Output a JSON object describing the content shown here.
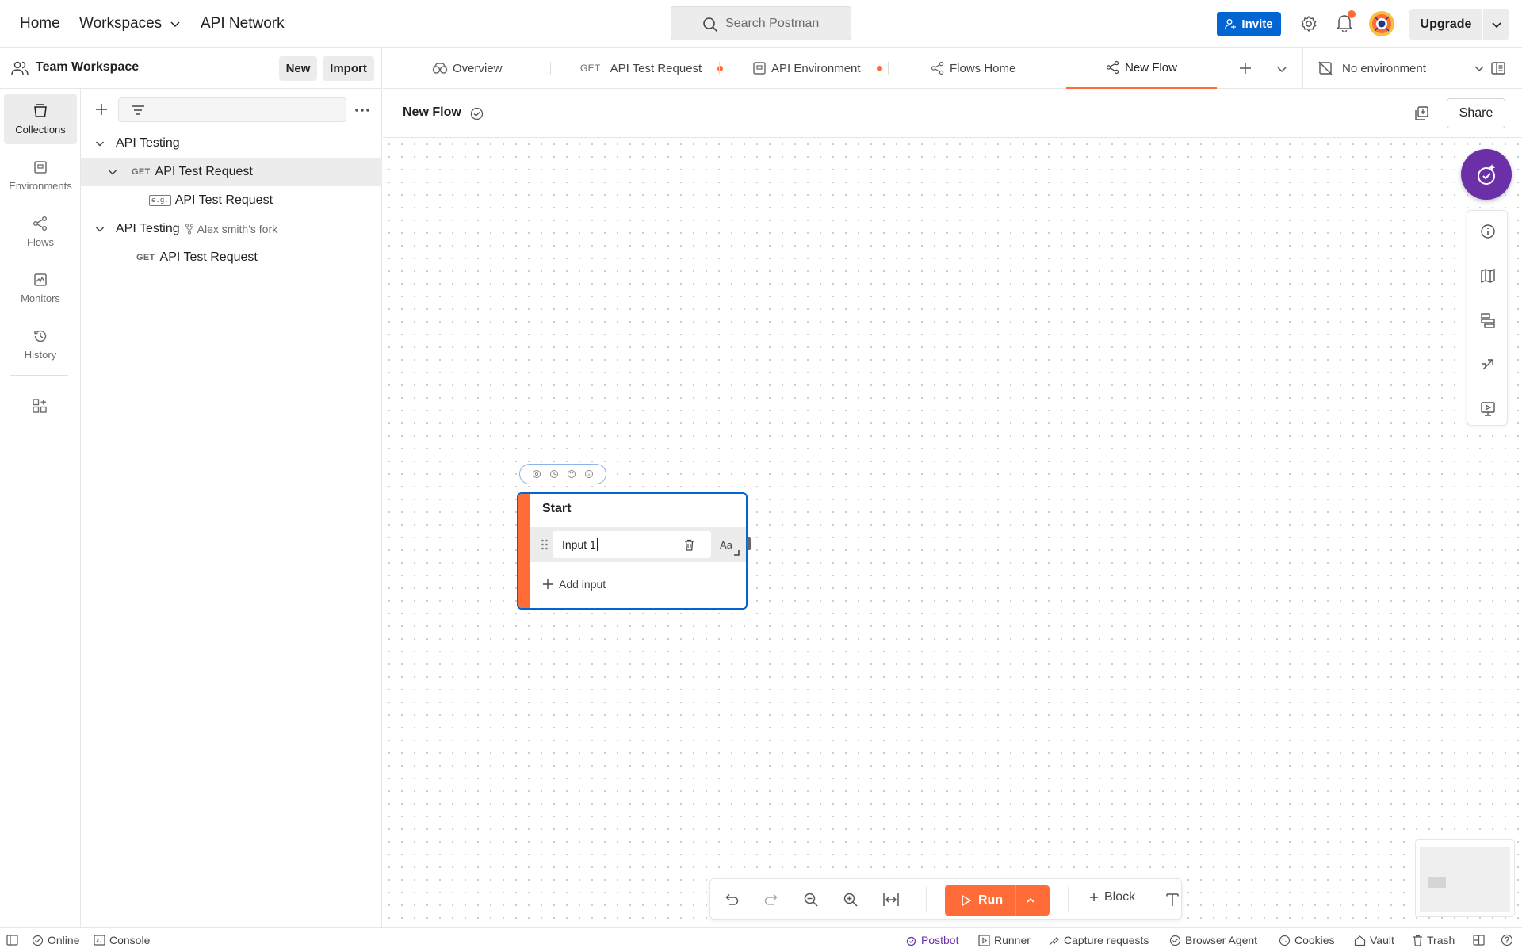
{
  "topbar": {
    "home": "Home",
    "workspaces": "Workspaces",
    "api_network": "API Network",
    "search_placeholder": "Search Postman",
    "invite": "Invite",
    "upgrade": "Upgrade"
  },
  "workspace": {
    "name": "Team Workspace",
    "new_label": "New",
    "import_label": "Import"
  },
  "rail": {
    "items": [
      {
        "label": "Collections",
        "icon": "collections-icon"
      },
      {
        "label": "Environments",
        "icon": "environments-icon"
      },
      {
        "label": "Flows",
        "icon": "flows-icon"
      },
      {
        "label": "Monitors",
        "icon": "monitors-icon"
      },
      {
        "label": "History",
        "icon": "history-icon"
      }
    ]
  },
  "tree": {
    "collection1": "API Testing",
    "request1_method": "GET",
    "request1": "API Test Request",
    "example1_badge": "e.g.",
    "example1": "API Test Request",
    "collection2": "API Testing",
    "fork_label": "Alex smith's fork",
    "request2_method": "GET",
    "request2": "API Test Request"
  },
  "tabs": {
    "items": [
      {
        "label": "Overview"
      },
      {
        "method": "GET",
        "label": "API Test Request",
        "unsaved": true
      },
      {
        "label": "API Environment",
        "unsaved": true
      },
      {
        "label": "Flows Home"
      },
      {
        "label": "New Flow",
        "active": true
      }
    ],
    "environment": "No environment"
  },
  "flow": {
    "title": "New Flow",
    "share": "Share",
    "start_block": {
      "title": "Start",
      "input_value": "Input 1",
      "type_label": "Aa",
      "add_input": "Add input"
    }
  },
  "toolbar": {
    "run": "Run",
    "block": "Block"
  },
  "status": {
    "online": "Online",
    "console": "Console",
    "postbot": "Postbot",
    "runner": "Runner",
    "capture": "Capture requests",
    "browser_agent": "Browser Agent",
    "cookies": "Cookies",
    "vault": "Vault",
    "trash": "Trash"
  },
  "colors": {
    "accent": "#ff6c37",
    "invite_blue": "#0265d2",
    "postbot_purple": "#6b2fa8",
    "block_border": "#0265d2"
  }
}
